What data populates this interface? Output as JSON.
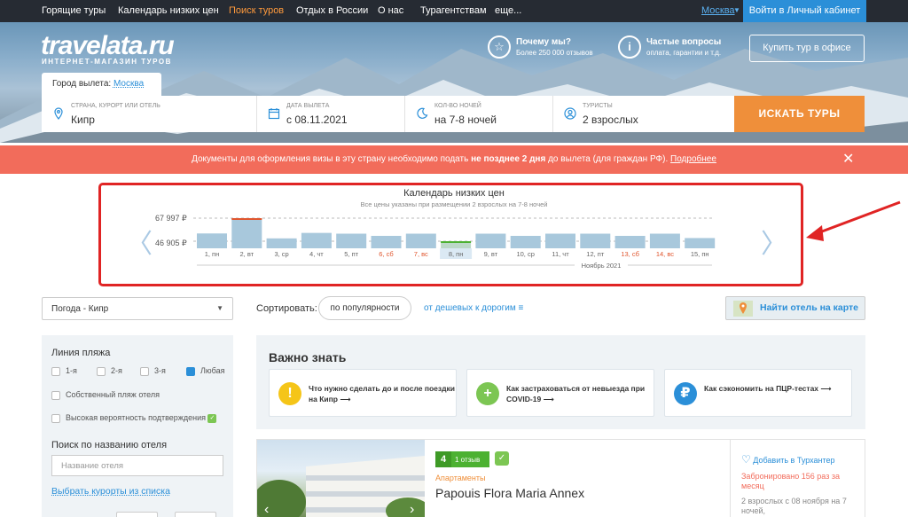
{
  "topnav": {
    "items": [
      "Горящие туры",
      "Календарь низких цен",
      "Поиск туров",
      "Отдых в России",
      "О нас",
      "Турагентствам",
      "еще..."
    ],
    "active_index": 2,
    "city": "Москва",
    "login": "Войти в Личный кабинет"
  },
  "header": {
    "logo": "travelata.ru",
    "logo_sub": "ИНТЕРНЕТ-МАГАЗИН ТУРОВ",
    "why_title": "Почему мы?",
    "why_sub": "Более 250 000 отзывов",
    "faq_title": "Частые вопросы",
    "faq_sub": "оплата, гарантии и т.д.",
    "buy_office": "Купить тур в офисе"
  },
  "search": {
    "departure_label": "Город вылета:",
    "departure_city": "Москва",
    "destination_label": "Страна, курорт или отель",
    "destination_value": "Кипр",
    "date_label": "Дата вылета",
    "date_value": "с 08.11.2021",
    "nights_label": "Кол-во ночей",
    "nights_value": "на 7-8 ночей",
    "tourists_label": "Туристы",
    "tourists_value": "2 взрослых",
    "button": "ИСКАТЬ ТУРЫ"
  },
  "banner": {
    "text_before": "Документы для оформления визы в эту страну необходимо подать ",
    "text_bold": "не позднее 2 дня",
    "text_after": " до вылета (для граждан РФ). ",
    "link": "Подробнее",
    "close": "✕"
  },
  "calendar": {
    "title": "Календарь низких цен",
    "subtitle": "Все цены указаны при размещении 2 взрослых на 7-8 ночей",
    "price_high": "67 997 ₽",
    "price_low": "46 905 ₽",
    "month": "Ноябрь 2021",
    "days": [
      {
        "label": "1, пн",
        "value": 54000,
        "weekend": false
      },
      {
        "label": "2, вт",
        "value": 67997,
        "weekend": false
      },
      {
        "label": "3, ср",
        "value": 49500,
        "weekend": false
      },
      {
        "label": "4, чт",
        "value": 54500,
        "weekend": false
      },
      {
        "label": "5, пт",
        "value": 53800,
        "weekend": false
      },
      {
        "label": "6, сб",
        "value": 51800,
        "weekend": true
      },
      {
        "label": "7, вс",
        "value": 53800,
        "weekend": true
      },
      {
        "label": "8, пн",
        "value": 46905,
        "weekend": false,
        "selected": true
      },
      {
        "label": "9, вт",
        "value": 53800,
        "weekend": false
      },
      {
        "label": "10, ср",
        "value": 51800,
        "weekend": false
      },
      {
        "label": "11, чт",
        "value": 53800,
        "weekend": false
      },
      {
        "label": "12, пт",
        "value": 53800,
        "weekend": false
      },
      {
        "label": "13, сб",
        "value": 51800,
        "weekend": true
      },
      {
        "label": "14, вс",
        "value": 53800,
        "weekend": true
      },
      {
        "label": "15, пн",
        "value": 49800,
        "weekend": false
      }
    ]
  },
  "filters": {
    "region": "Погода - Кипр",
    "sort_label": "Сортировать:",
    "sort_active": "по популярности",
    "sort_cheap": "от дешевых к дорогим",
    "map_button": "Найти отель на карте"
  },
  "sidebar": {
    "beach_line": "Линия пляжа",
    "beach_options": [
      "1-я",
      "2-я",
      "3-я",
      "Любая"
    ],
    "own_beach": "Собственный пляж отеля",
    "high_confirm": "Высокая вероятность подтверждения",
    "hotel_search": "Поиск по названию отеля",
    "hotel_placeholder": "Название отеля",
    "choose_resorts": "Выбрать курорты из списка"
  },
  "important": {
    "title": "Важно знать",
    "cards": [
      {
        "text": "Что нужно сделать до и после поездки на Кипр ⟶",
        "icon": "!",
        "color": "#f5c518"
      },
      {
        "text": "Как застраховаться от невыезда при COVID-19 ⟶",
        "icon": "+",
        "color": "#7cc653"
      },
      {
        "text": "Как сэкономить на ПЦР-тестах ⟶",
        "icon": "₽",
        "color": "#2b8fd8"
      }
    ]
  },
  "hotel": {
    "rating": "4",
    "reviews": "1 отзыв",
    "type": "Апартаменты",
    "name": "Papouis Flora Maria Annex",
    "favorite": "Добавить в Турхантер",
    "booked": "Забронировано 156 раз за месяц",
    "tour": "2 взрослых с 08 ноября на 7 ночей,"
  }
}
